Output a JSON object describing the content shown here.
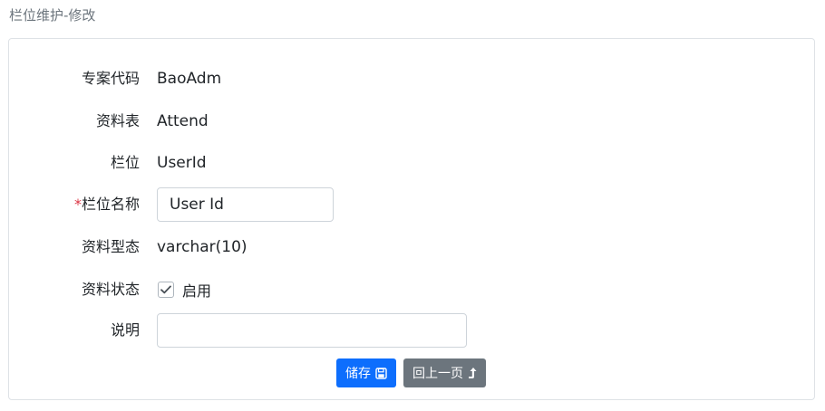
{
  "page": {
    "title": "栏位维护-修改"
  },
  "form": {
    "project_code": {
      "label": "专案代码",
      "value": "BaoAdm"
    },
    "table": {
      "label": "资料表",
      "value": "Attend"
    },
    "field": {
      "label": "栏位",
      "value": "UserId"
    },
    "field_name": {
      "required_mark": "*",
      "label": "栏位名称",
      "value": "User Id"
    },
    "data_type": {
      "label": "资料型态",
      "value": "varchar(10)"
    },
    "status": {
      "label": "资料状态",
      "checkbox_label": "启用",
      "checked": true
    },
    "description": {
      "label": "说明",
      "value": ""
    }
  },
  "actions": {
    "save_label": "储存",
    "save_icon": "floppy-disk-icon",
    "back_label": "回上一页",
    "back_icon": "arrow-up-return-icon"
  },
  "colors": {
    "primary": "#0d6efd",
    "secondary": "#6c757d",
    "required": "#dc3545",
    "muted": "#6c757d"
  }
}
